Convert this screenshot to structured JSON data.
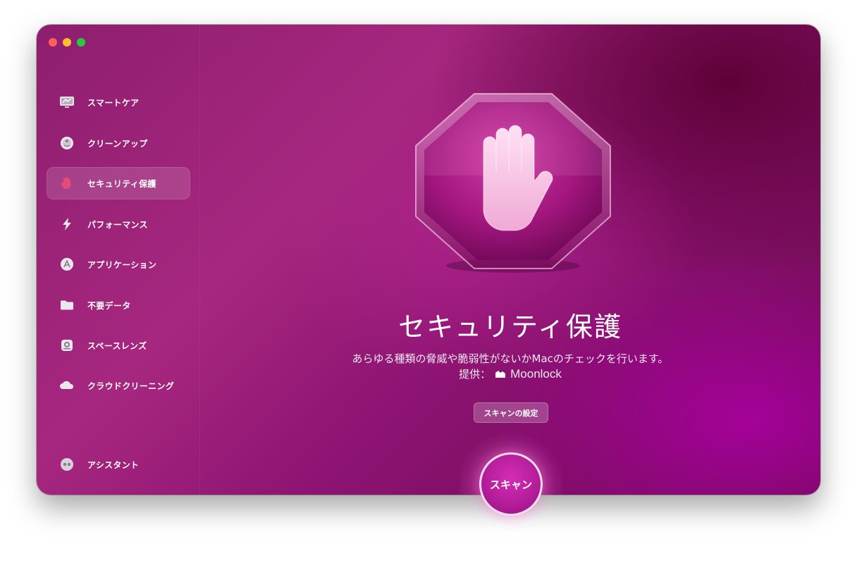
{
  "window": {
    "traffic_lights": [
      "close",
      "minimize",
      "zoom"
    ]
  },
  "sidebar": {
    "items": [
      {
        "label": "スマートケア",
        "icon": "smart-care-icon",
        "active": false
      },
      {
        "label": "クリーンアップ",
        "icon": "cleanup-icon",
        "active": false
      },
      {
        "label": "セキュリティ保護",
        "icon": "hand-icon",
        "active": true
      },
      {
        "label": "パフォーマンス",
        "icon": "lightning-icon",
        "active": false
      },
      {
        "label": "アプリケーション",
        "icon": "applications-icon",
        "active": false
      },
      {
        "label": "不要データ",
        "icon": "folder-icon",
        "active": false
      },
      {
        "label": "スペースレンズ",
        "icon": "space-lens-icon",
        "active": false
      },
      {
        "label": "クラウドクリーニング",
        "icon": "cloud-icon",
        "active": false
      }
    ],
    "assistant": {
      "label": "アシスタント",
      "icon": "assistant-icon"
    }
  },
  "main": {
    "title": "セキュリティ保護",
    "description": "あらゆる種類の脅威や脆弱性がないかMacのチェックを行います。",
    "provider_prefix": "提供：",
    "provider_name": "Moonlock",
    "settings_button": "スキャンの設定",
    "scan_button": "スキャン"
  },
  "colors": {
    "accent": "#b21c98",
    "background": "#8e1e6f"
  }
}
